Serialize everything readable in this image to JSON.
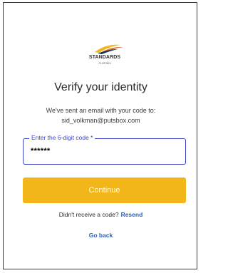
{
  "logo": {
    "name": "STANDARDS",
    "sub": "Australia",
    "swoosh_colors": [
      "#f2b51a",
      "#e8732a",
      "#1f2f5c"
    ]
  },
  "title": "Verify your identity",
  "message": {
    "line1": "We've sent an email with your code to:",
    "email": "sid_volkman@putsbox.com"
  },
  "code_field": {
    "label": "Enter the 6-digit code *",
    "value": "******"
  },
  "continue_label": "Continue",
  "resend": {
    "prompt": "Didn't receive a code?",
    "link": "Resend"
  },
  "go_back_label": "Go back",
  "colors": {
    "accent": "#f2b51a",
    "link": "#2e5fb4",
    "focus": "#3a45c7"
  }
}
